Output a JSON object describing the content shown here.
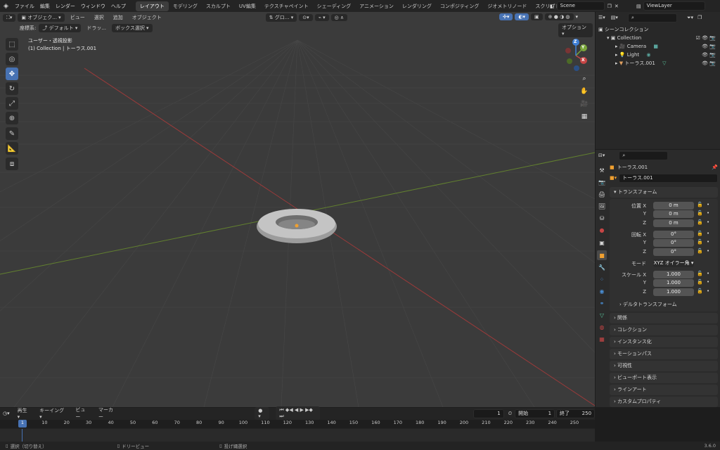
{
  "topbar": {
    "menus": [
      "ファイル",
      "編集",
      "レンダー",
      "ウィンドウ",
      "ヘルプ"
    ],
    "workspaces": [
      "レイアウト",
      "モデリング",
      "スカルプト",
      "UV編集",
      "テクスチャペイント",
      "シェーディング",
      "アニメーション",
      "レンダリング",
      "コンポジティング",
      "ジオメトリノード",
      "スクリプト"
    ],
    "active_workspace": "レイアウト",
    "scene": "Scene",
    "view_layer": "ViewLayer"
  },
  "viewport_header": {
    "mode": "オブジェク...",
    "menus": [
      "ビュー",
      "選択",
      "追加",
      "オブジェクト"
    ],
    "orientation": "グロ...",
    "coord_label": "座標系:",
    "coord_value": "デフォルト",
    "drag_label": "ドラッ...",
    "select_mode": "ボックス選択",
    "options": "オプション"
  },
  "viewport_overlay": {
    "view_name": "ユーザー・透視投影",
    "collection_info": "(1) Collection | トーラス.001"
  },
  "gizmo": {
    "x": "X",
    "y": "Y",
    "z": "Z"
  },
  "outliner": {
    "search_placeholder": "",
    "scene_collection": "シーンコレクション",
    "collection": "Collection",
    "items": [
      {
        "name": "Camera"
      },
      {
        "name": "Light"
      },
      {
        "name": "トーラス.001"
      }
    ]
  },
  "properties": {
    "object_name": "トーラス.001",
    "object_field": "トーラス.001",
    "transform_header": "トランスフォーム",
    "location": {
      "label": "位置 X",
      "x": "0 m",
      "y": "0 m",
      "z": "0 m"
    },
    "rotation": {
      "label": "回転 X",
      "x": "0°",
      "y": "0°",
      "z": "0°"
    },
    "mode_label": "モード",
    "mode_value": "XYZ オイラー角",
    "scale": {
      "label": "スケール X",
      "x": "1.000",
      "y": "1.000",
      "z": "1.000"
    },
    "axis_y": "Y",
    "axis_z": "Z",
    "delta_transform": "デルタトランスフォーム",
    "panels": [
      "関係",
      "コレクション",
      "インスタンス化",
      "モーションパス",
      "可視性",
      "ビューポート表示",
      "ラインアート",
      "カスタムプロパティ"
    ]
  },
  "timeline": {
    "menus": [
      "再生",
      "キーイング",
      "ビュー",
      "マーカー"
    ],
    "current_frame": "1",
    "start_label": "開始",
    "start": "1",
    "end_label": "終了",
    "end": "250",
    "ticks": [
      "1",
      "10",
      "20",
      "30",
      "40",
      "50",
      "60",
      "70",
      "80",
      "90",
      "100",
      "110",
      "120",
      "130",
      "140",
      "150",
      "160",
      "170",
      "180",
      "190",
      "200",
      "210",
      "220",
      "230",
      "240",
      "250"
    ]
  },
  "statusbar": {
    "select": "選択（切り替え）",
    "pan": "ドリービュー",
    "context": "投げ縄選択",
    "version": "3.6.0"
  },
  "colors": {
    "accent": "#4772b3",
    "x_axis": "#c64545",
    "y_axis": "#7aa63a",
    "z_axis": "#3f7fd6",
    "torus": "#bdbdbd"
  }
}
